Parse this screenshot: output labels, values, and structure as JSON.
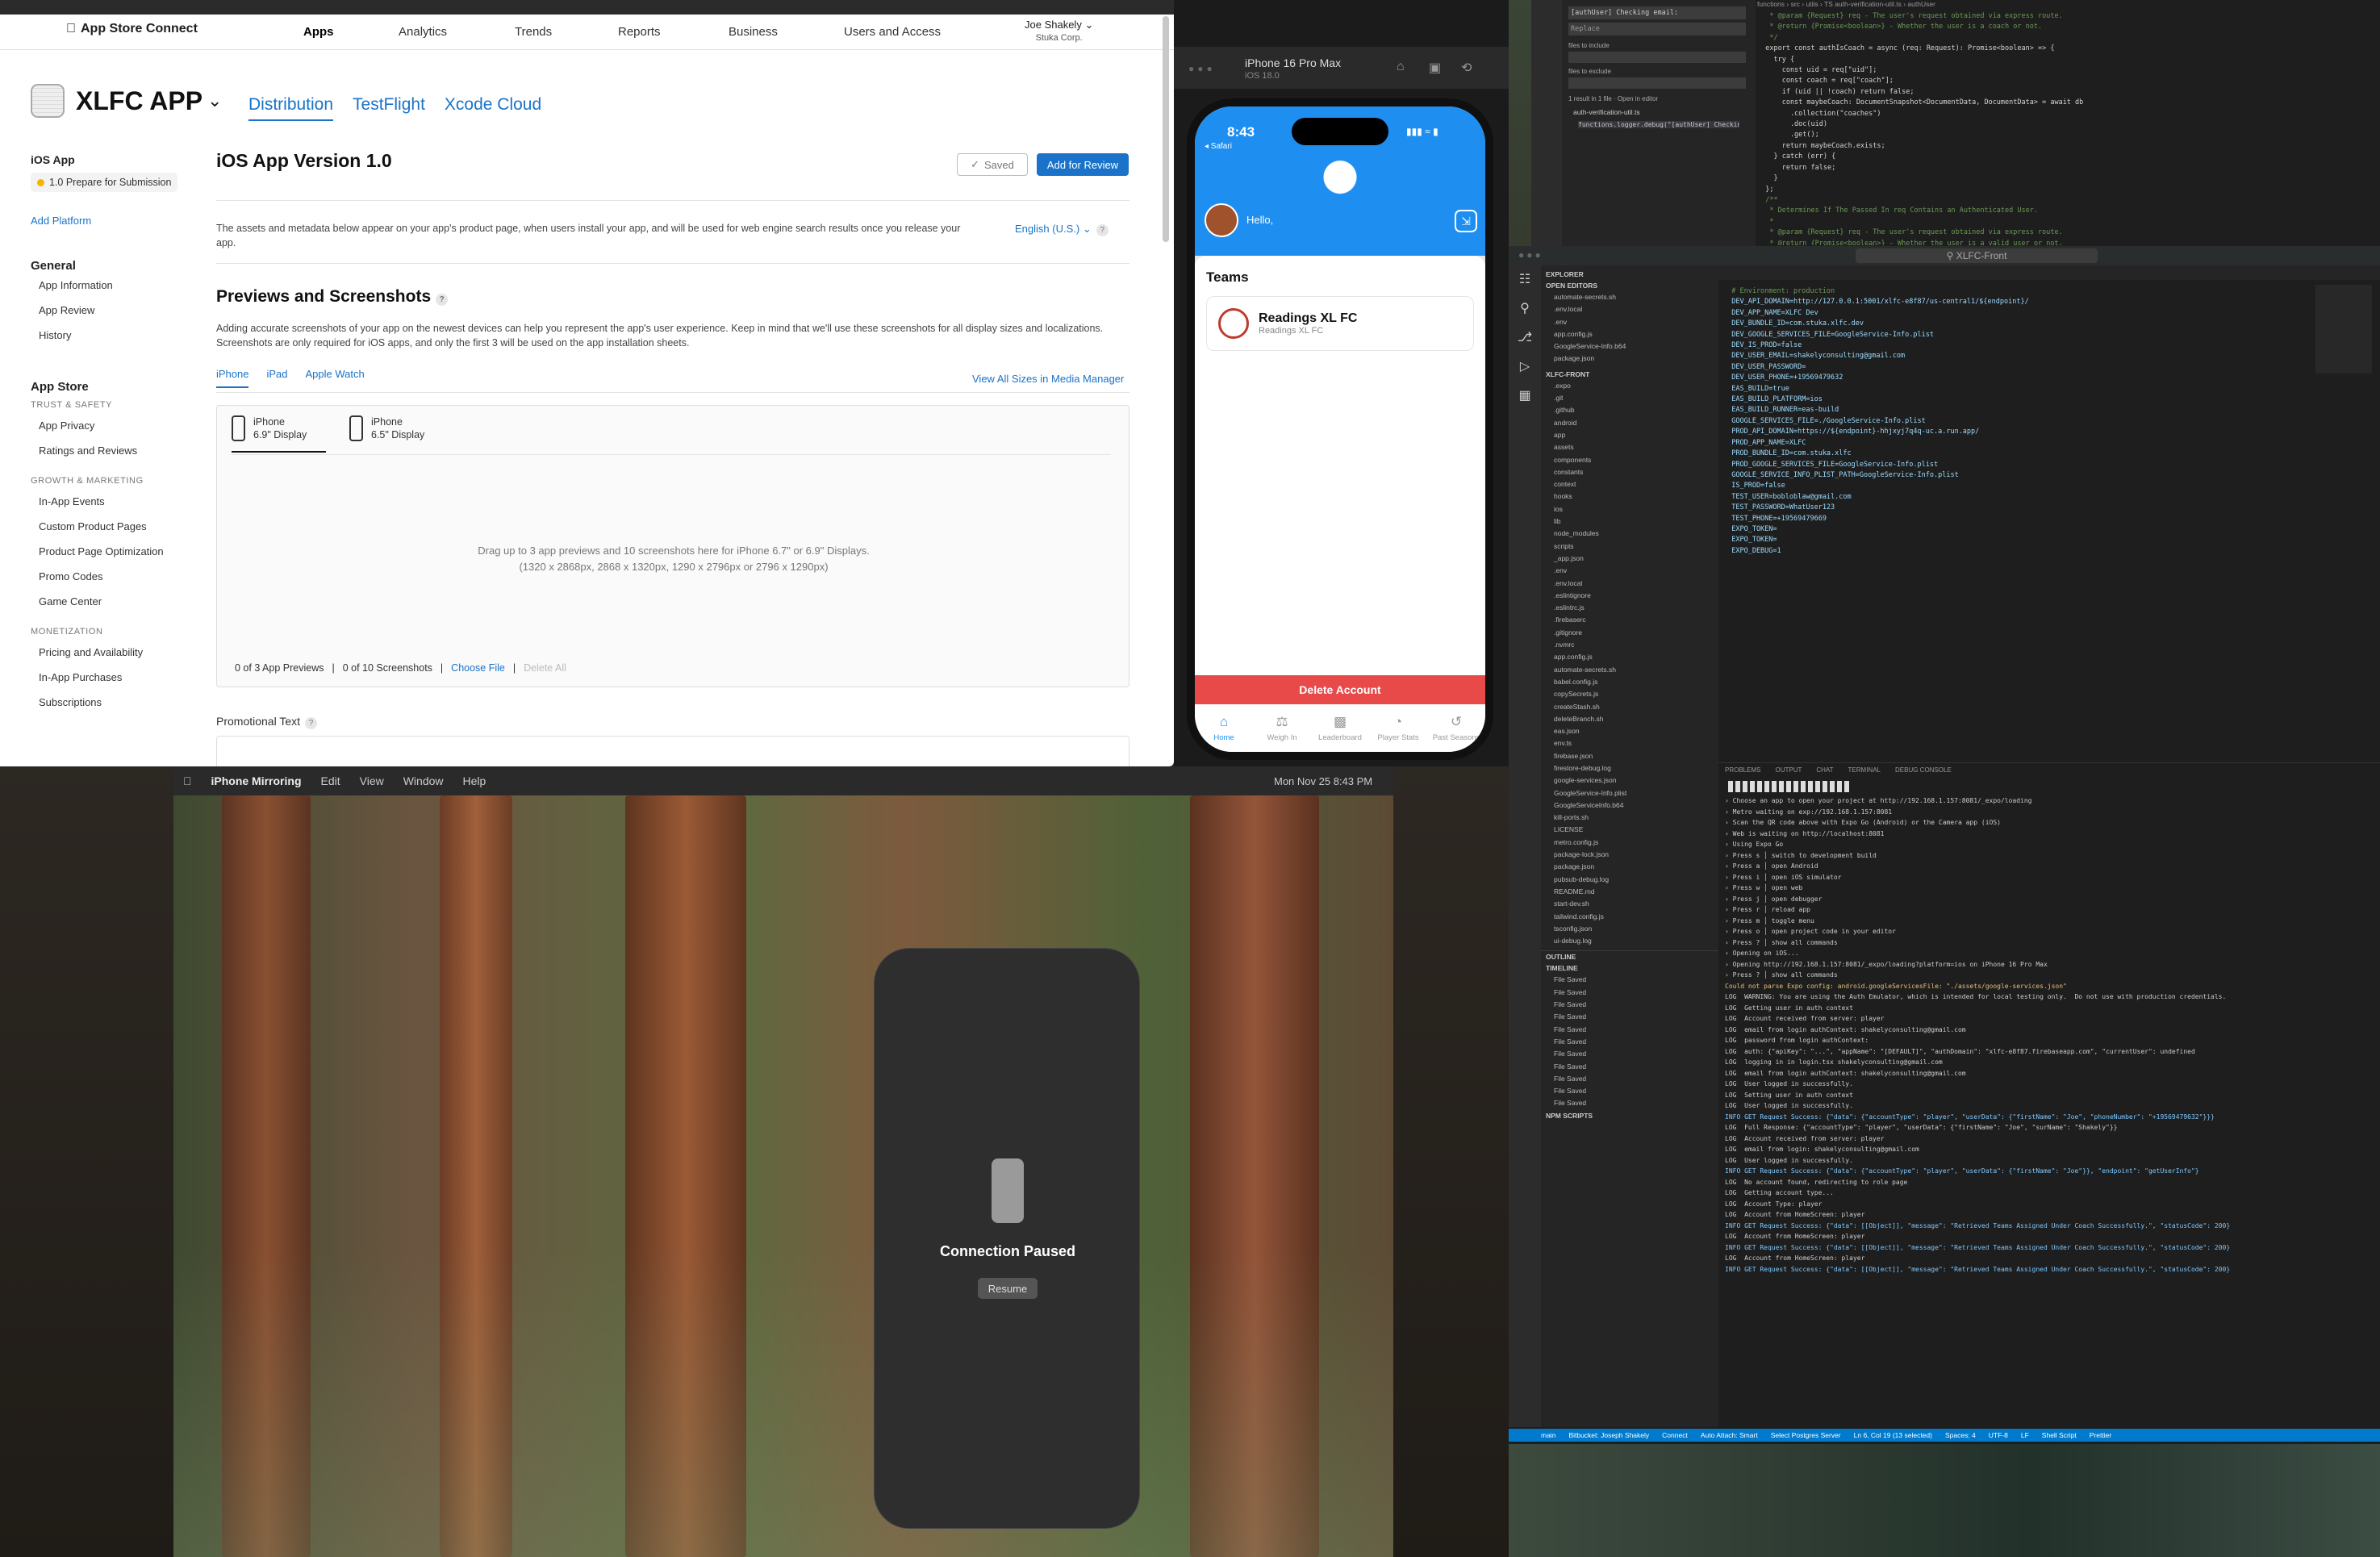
{
  "asc": {
    "brand": "App Store Connect",
    "nav": [
      "Apps",
      "Analytics",
      "Trends",
      "Reports",
      "Business",
      "Users and Access"
    ],
    "user_name": "Joe Shakely",
    "user_org": "Stuka Corp.",
    "app_name": "XLFC APP",
    "tabs": [
      "Distribution",
      "TestFlight",
      "Xcode Cloud"
    ],
    "sidebar": {
      "ios_app": "iOS App",
      "version_chip": "1.0 Prepare for Submission",
      "add_platform": "Add Platform",
      "general_h": "General",
      "general": [
        "App Information",
        "App Review",
        "History"
      ],
      "store_h": "App Store",
      "trust_h": "TRUST & SAFETY",
      "trust": [
        "App Privacy",
        "Ratings and Reviews"
      ],
      "growth_h": "GROWTH & MARKETING",
      "growth": [
        "In-App Events",
        "Custom Product Pages",
        "Product Page Optimization",
        "Promo Codes",
        "Game Center"
      ],
      "money_h": "MONETIZATION",
      "money": [
        "Pricing and Availability",
        "In-App Purchases",
        "Subscriptions"
      ]
    },
    "main": {
      "title": "iOS App Version 1.0",
      "saved": "Saved",
      "add_review": "Add for Review",
      "desc": "The assets and metadata below appear on your app's product page, when users install your app, and will be used for web engine search results once you release your app.",
      "lang": "English (U.S.)",
      "previews_title": "Previews and Screenshots",
      "previews_desc": "Adding accurate screenshots of your app on the newest devices can help you represent the app's user experience. Keep in mind that we'll use these screenshots for all display sizes and localizations. Screenshots are only required for iOS apps, and only the first 3 will be used on the app installation sheets.",
      "device_tabs": [
        "iPhone",
        "iPad",
        "Apple Watch"
      ],
      "view_all": "View All Sizes in Media Manager",
      "disp1": [
        "iPhone",
        "6.9\" Display"
      ],
      "disp2": [
        "iPhone",
        "6.5\" Display"
      ],
      "drop1": "Drag up to 3 app previews and 10 screenshots here for iPhone 6.7\" or 6.9\" Displays.",
      "drop2": "(1320 x 2868px, 2868 x 1320px, 1290 x 2796px or 2796 x 1290px)",
      "foot_previews": "0 of 3 App Previews",
      "foot_shots": "0 of 10 Screenshots",
      "choose_file": "Choose File",
      "delete_all": "Delete All",
      "promo": "Promotional Text"
    }
  },
  "sim": {
    "device": "iPhone 16 Pro Max",
    "os": "iOS 18.0",
    "time": "8:43",
    "back": "◂ Safari",
    "hello": "Hello,",
    "teams": "Teams",
    "team_name": "Readings XL FC",
    "team_sub": "Readings XL FC",
    "delete": "Delete Account",
    "tabs": [
      "Home",
      "Weigh In",
      "Leaderboard",
      "Player Stats",
      "Past Seasons"
    ]
  },
  "vscode": {
    "title": "XLFC-Front",
    "explorer_h": "EXPLORER",
    "open_editors": "OPEN EDITORS",
    "open_files": [
      "automate-secrets.sh",
      ".env.local",
      ".env",
      "app.config.js",
      "GoogleService-Info.b64",
      "package.json"
    ],
    "project": "XLFC-FRONT",
    "files": [
      ".expo",
      ".git",
      ".github",
      "android",
      "app",
      "assets",
      "components",
      "constants",
      "context",
      "hooks",
      "ios",
      "lib",
      "node_modules",
      "scripts",
      "_app.json",
      ".env",
      ".env.local",
      ".eslintignore",
      ".eslintrc.js",
      ".firebaserc",
      ".gitignore",
      ".nvmrc",
      "app.config.js",
      "automate-secrets.sh",
      "babel.config.js",
      "copySecrets.js",
      "createStash.sh",
      "deleteBranch.sh",
      "eas.json",
      "env.ts",
      "firebase.json",
      "firestore-debug.log",
      "google-services.json",
      "GoogleService-Info.plist",
      "GoogleServiceInfo.b64",
      "kill-ports.sh",
      "LICENSE",
      "metro.config.js",
      "package-lock.json",
      "package.json",
      "pubsub-debug.log",
      "README.md",
      "start-dev.sh",
      "tailwind.config.js",
      "tsconfig.json",
      "ui-debug.log"
    ],
    "outline": "OUTLINE",
    "timeline": "TIMELINE",
    "timeline_items": [
      "File Saved",
      "File Saved",
      "File Saved",
      "File Saved",
      "File Saved",
      "File Saved",
      "File Saved",
      "File Saved",
      "File Saved",
      "File Saved",
      "File Saved"
    ],
    "npm": "NPM SCRIPTS",
    "code": [
      "  # Environment: production",
      "  DEV_API_DOMAIN=http://127.0.0.1:5001/xlfc-e8f87/us-central1/${endpoint}/",
      "  DEV_APP_NAME=XLFC Dev",
      "  DEV_BUNDLE_ID=com.stuka.xlfc.dev",
      "  DEV_GOOGLE_SERVICES_FILE=GoogleService-Info.plist",
      "  DEV_IS_PROD=false",
      "  DEV_USER_EMAIL=shakelyconsulting@gmail.com",
      "  DEV_USER_PASSWORD=",
      "  DEV_USER_PHONE=+19569479632",
      "  EAS_BUILD=true",
      "  EAS_BUILD_PLATFORM=ios",
      "  EAS_BUILD_RUNNER=eas-build",
      "  GOOGLE_SERVICES_FILE=./GoogleService-Info.plist",
      "  PROD_API_DOMAIN=https://${endpoint}-hhjxyj7q4q-uc.a.run.app/",
      "  PROD_APP_NAME=XLFC",
      "  PROD_BUNDLE_ID=com.stuka.xlfc",
      "  PROD_GOOGLE_SERVICES_FILE=GoogleService-Info.plist",
      "  GOOGLE_SERVICE_INFO_PLIST_PATH=GoogleService-Info.plist",
      "  IS_PROD=false",
      "  TEST_USER=bobloblaw@gmail.com",
      "  TEST_PASSWORD=WhatUser123",
      "  TEST_PHONE=+19569479669",
      "  EXPO_TOKEN=",
      "  EXPO_TOKEN=",
      "  EXPO_DEBUG=1"
    ],
    "terminal_tabs": [
      "PROBLEMS",
      "OUTPUT",
      "CHAT",
      "TERMINAL",
      "DEBUG CONSOLE"
    ],
    "terminal": [
      "› Choose an app to open your project at http://192.168.1.157:8081/_expo/loading",
      "› Metro waiting on exp://192.168.1.157:8081",
      "› Scan the QR code above with Expo Go (Android) or the Camera app (iOS)",
      "",
      "› Web is waiting on http://localhost:8081",
      "",
      "› Using Expo Go",
      "› Press s │ switch to development build",
      "",
      "› Press a │ open Android",
      "› Press i │ open iOS simulator",
      "› Press w │ open web",
      "",
      "› Press j │ open debugger",
      "› Press r │ reload app",
      "› Press m │ toggle menu",
      "› Press o │ open project code in your editor",
      "",
      "› Press ? │ show all commands",
      "",
      "› Opening on iOS...",
      "› Opening http://192.168.1.157:8081/_expo/loading?platform=ios on iPhone 16 Pro Max",
      "› Press ? │ show all commands",
      "Could not parse Expo config: android.googleServicesFile: \"./assets/google-services.json\"",
      "LOG  WARNING: You are using the Auth Emulator, which is intended for local testing only.  Do not use with production credentials.",
      "LOG  Getting user in auth context",
      "LOG  Account received from server: player",
      "LOG  email from login authContext: shakelyconsulting@gmail.com",
      "LOG  password from login authContext:",
      "LOG  auth: {\"apiKey\": \"...\", \"appName\": \"[DEFAULT]\", \"authDomain\": \"xlfc-e8f87.firebaseapp.com\", \"currentUser\": undefined",
      "",
      "LOG  logging in in login.tsx shakelyconsulting@gmail.com",
      "LOG  email from login authContext: shakelyconsulting@gmail.com",
      "LOG  User logged in successfully.",
      "LOG  Setting user in auth context",
      "LOG  User logged in successfully.",
      "INFO GET Request Success: {\"data\": {\"accountType\": \"player\", \"userData\": {\"firstName\": \"Joe\", \"phoneNumber\": \"+19569479632\"}}}",
      "LOG  Full Response: {\"accountType\": \"player\", \"userData\": {\"firstName\": \"Joe\", \"surName\": \"Shakely\"}}",
      "LOG  Account received from server: player",
      "LOG  email from login: shakelyconsulting@gmail.com",
      "LOG  User logged in successfully.",
      "INFO GET Request Success: {\"data\": {\"accountType\": \"player\", \"userData\": {\"firstName\": \"Joe\"}}, \"endpoint\": \"getUserInfo\"}",
      "",
      "LOG  No account found, redirecting to role page",
      "LOG  Getting account type...",
      "LOG  Account Type: player",
      "LOG  Account from HomeScreen: player",
      "INFO GET Request Success: {\"data\": [[Object]], \"message\": \"Retrieved Teams Assigned Under Coach Successfully.\", \"statusCode\": 200}",
      "LOG  Account from HomeScreen: player",
      "INFO GET Request Success: {\"data\": [[Object]], \"message\": \"Retrieved Teams Assigned Under Coach Successfully.\", \"statusCode\": 200}",
      "LOG  Account from HomeScreen: player",
      "INFO GET Request Success: {\"data\": [[Object]], \"message\": \"Retrieved Teams Assigned Under Coach Successfully.\", \"statusCode\": 200}"
    ],
    "status": [
      "main",
      "Bitbucket: Joseph Shakely",
      "Connect",
      "Auto Attach: Smart",
      "Select Postgres Server",
      "Ln 6, Col 19 (13 selected)",
      "Spaces: 4",
      "UTF-8",
      "LF",
      "Shell Script",
      "Prettier"
    ]
  },
  "vs_top": {
    "search_line": "[authUser] Checking email:",
    "replace": "Replace",
    "include": "files to include",
    "exclude": "files to exclude",
    "result": "1 result in 1 file · Open in editor",
    "result_file": "auth-verification-util.ts",
    "match": "functions.logger.debug(\"[authUser] Checking email\", em...",
    "breadcrumb": "functions › src › utils › TS auth-verification-util.ts › authUser",
    "code": [
      "   * @param {Request} req - The user's request obtained via express route.",
      "   * @return {Promise<boolean>} - Whether the user is a coach or not.",
      "   */",
      "  export const authIsCoach = async (req: Request): Promise<boolean> => {",
      "    try {",
      "      const uid = req[\"uid\"];",
      "      const coach = req[\"coach\"];",
      "      if (uid || !coach) return false;",
      "      const maybeCoach: DocumentSnapshot<DocumentData, DocumentData> = await db",
      "        .collection(\"coaches\")",
      "        .doc(uid)",
      "        .get();",
      "      return maybeCoach.exists;",
      "    } catch (err) {",
      "      return false;",
      "    }",
      "  };",
      "",
      "  /**",
      "   * Determines If The Passed In req Contains an Authenticated User.",
      "   *",
      "   * @param {Request} req - The user's request obtained via express route.",
      "   * @return {Promise<boolean>} - Whether the user is a valid user or not."
    ],
    "line_start": 52
  },
  "mirror": {
    "menu": [
      "iPhone Mirroring",
      "Edit",
      "View",
      "Window",
      "Help"
    ],
    "clock": "Mon Nov 25  8:43 PM",
    "paused": "Connection Paused",
    "resume": "Resume"
  }
}
